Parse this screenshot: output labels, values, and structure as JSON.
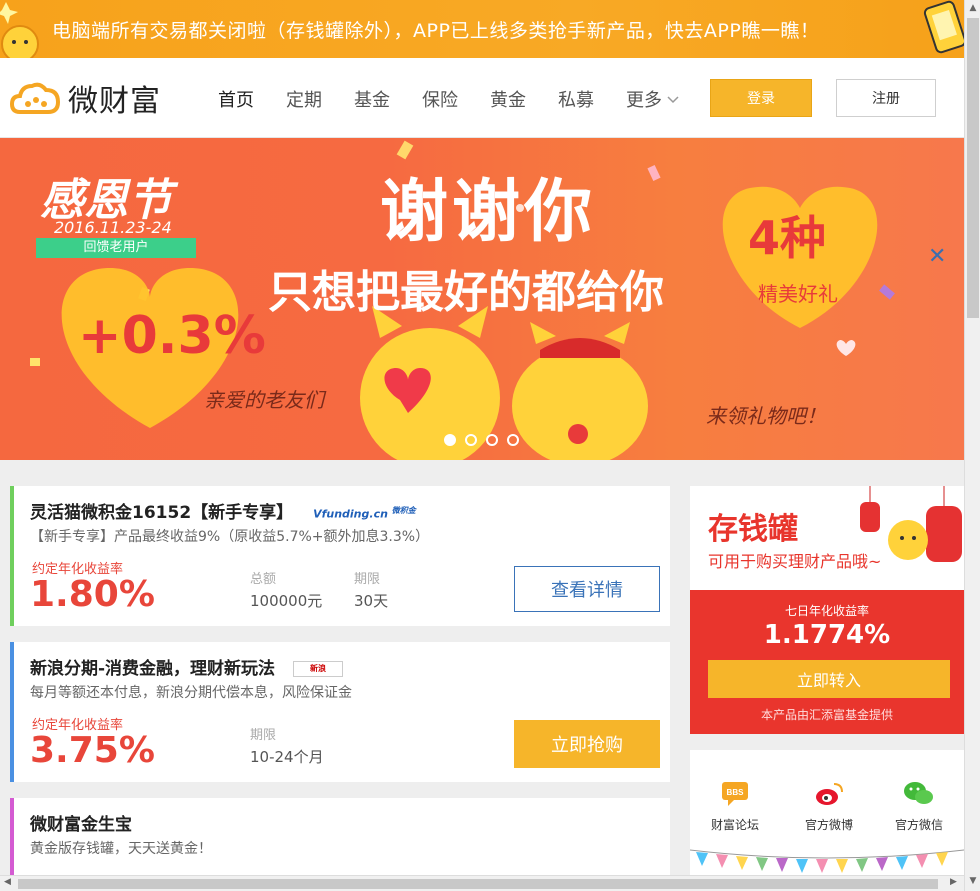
{
  "notice": {
    "text": "电脑端所有交易都关闭啦（存钱罐除外），APP已上线多类抢手新产品，快去APP瞧一瞧！"
  },
  "header": {
    "logo_text": "微财富",
    "nav": [
      "首页",
      "定期",
      "基金",
      "保险",
      "黄金",
      "私募",
      "更多"
    ],
    "login_label": "登录",
    "register_label": "注册"
  },
  "banner": {
    "festival": "感恩节",
    "date": "2016.11.23-24",
    "tag": "回馈老用户",
    "headline": "谢谢你",
    "subheadline": "只想把最好的都给你",
    "bonus": "+0.3%",
    "gift_count": "4种",
    "gift_label": "精美好礼",
    "left_caption": "亲爱的老友们",
    "right_caption": "来领礼物吧！",
    "slides": 4,
    "active_slide": 1
  },
  "products": [
    {
      "title": "灵活猫微积金16152【新手专享】",
      "brand": "Vfunding.cn",
      "brand_tag": "微积金",
      "desc": "【新手专享】产品最终收益9%（原收益5.7%+额外加息3.3%）",
      "rate_label": "约定年化收益率",
      "rate": "1.80%",
      "amount_label": "总额",
      "amount": "100000元",
      "term_label": "期限",
      "term": "30天",
      "button": "查看详情"
    },
    {
      "title": "新浪分期-消费金融，理财新玩法",
      "brand": "新浪",
      "desc": "每月等额还本付息，新浪分期代偿本息，风险保证金",
      "rate_label": "约定年化收益率",
      "rate": "3.75%",
      "term_label": "期限",
      "term": "10-24个月",
      "button": "立即抢购"
    },
    {
      "title": "微财富金生宝",
      "desc": "黄金版存钱罐，天天送黄金！"
    }
  ],
  "piggy": {
    "title": "存钱罐",
    "subtitle": "可用于购买理财产品哦~",
    "rate_label": "七日年化收益率",
    "rate": "1.1774%",
    "button": "立即转入",
    "note": "本产品由汇添富基金提供"
  },
  "social": [
    {
      "label": "财富论坛",
      "icon": "bbs-icon",
      "icon_text": "BBS"
    },
    {
      "label": "官方微博",
      "icon": "weibo-icon"
    },
    {
      "label": "官方微信",
      "icon": "wechat-icon"
    }
  ],
  "colors": {
    "brand_orange": "#f6b52a",
    "rate_red": "#e8463a",
    "piggy_red": "#e9352d",
    "link_blue": "#3a73b8"
  }
}
